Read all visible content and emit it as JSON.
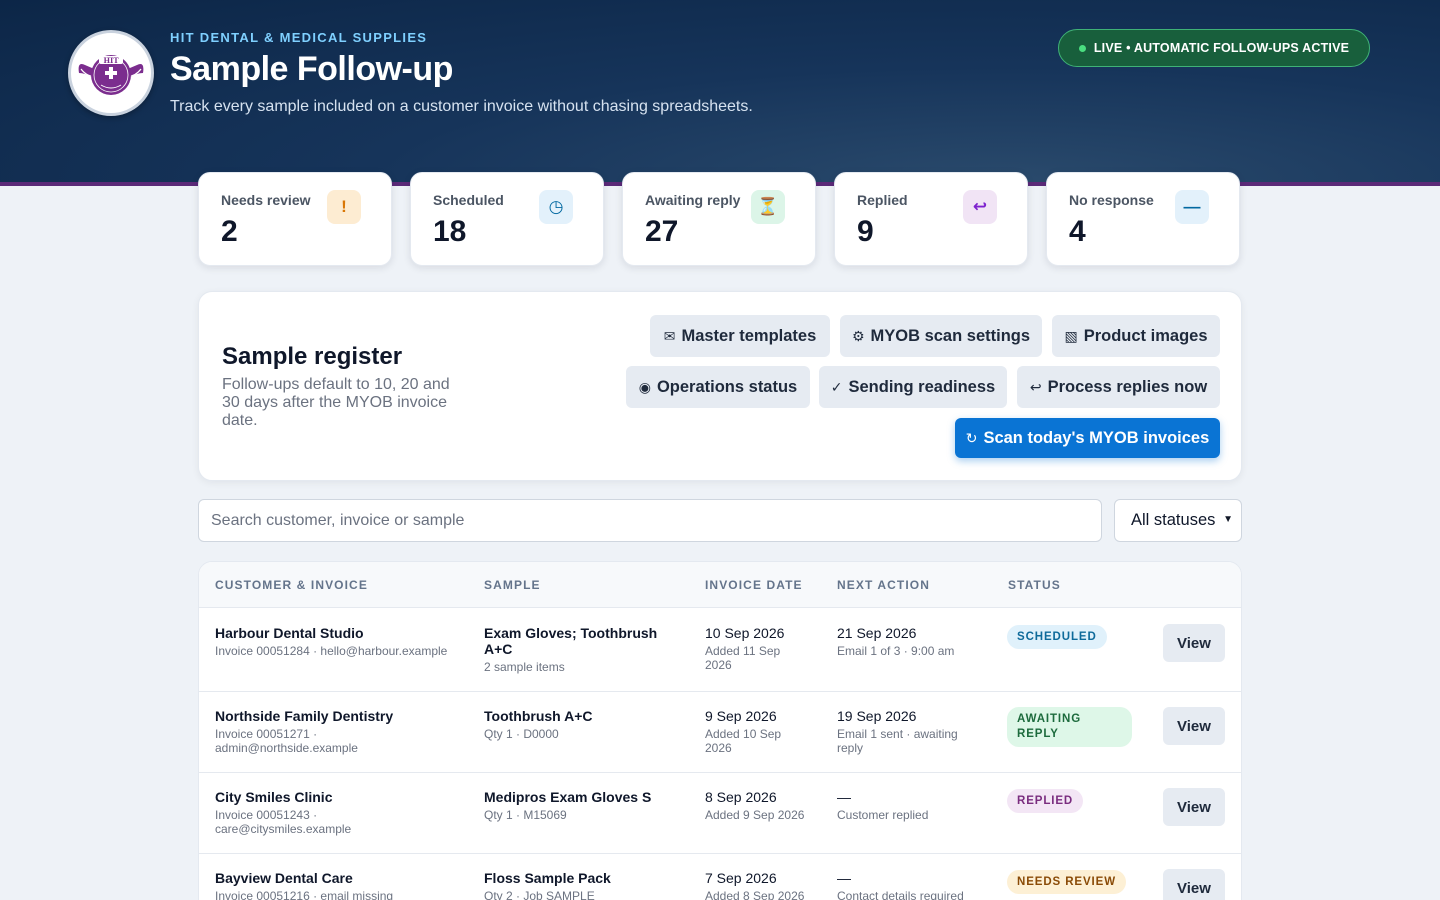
{
  "header": {
    "brand": "HIT DENTAL & MEDICAL SUPPLIES",
    "title": "Sample Follow-up",
    "subtitle": "Track every sample included on a customer invoice without chasing spreadsheets.",
    "live_badge": "LIVE • AUTOMATIC FOLLOW-UPS ACTIVE",
    "logo_text": "HIT"
  },
  "stats": [
    {
      "label": "Needs review",
      "value": "2",
      "icon": "!",
      "icon_name": "exclamation-icon",
      "color": "#d97706",
      "bg": "#fdecd2"
    },
    {
      "label": "Scheduled",
      "value": "18",
      "icon": "◷",
      "icon_name": "clock-icon",
      "color": "#0369a1",
      "bg": "#e3f1fb"
    },
    {
      "label": "Awaiting reply",
      "value": "27",
      "icon": "⏳",
      "icon_name": "hourglass-icon",
      "color": "#a16207",
      "bg": "#dcf5e8"
    },
    {
      "label": "Replied",
      "value": "9",
      "icon": "↩",
      "icon_name": "reply-icon",
      "color": "#7e22ce",
      "bg": "#f1e4f5"
    },
    {
      "label": "No response",
      "value": "4",
      "icon": "—",
      "icon_name": "dash-icon",
      "color": "#0369a1",
      "bg": "#e3f1fb"
    }
  ],
  "register": {
    "title": "Sample register",
    "description": "Follow-ups default to 10, 20 and 30 days after the MYOB invoice date.",
    "buttons": {
      "master_templates": {
        "icon": "✉",
        "label": "Master templates"
      },
      "myob_scan_settings": {
        "icon": "⚙",
        "label": "MYOB scan settings"
      },
      "product_images": {
        "icon": "▧",
        "label": "Product images"
      },
      "operations_status": {
        "icon": "◉",
        "label": "Operations status"
      },
      "sending_readiness": {
        "icon": "✓",
        "label": "Sending readiness"
      },
      "process_replies": {
        "icon": "↩",
        "label": "Process replies now"
      },
      "scan_invoices": {
        "icon": "↻",
        "label": "Scan today's MYOB invoices"
      }
    }
  },
  "filters": {
    "search_placeholder": "Search customer, invoice or sample",
    "status_selected": "All statuses"
  },
  "table": {
    "columns": [
      "CUSTOMER & INVOICE",
      "SAMPLE",
      "INVOICE DATE",
      "NEXT ACTION",
      "STATUS"
    ],
    "view_label": "View",
    "rows": [
      {
        "customer": "Harbour Dental Studio",
        "invoice": "Invoice 00051284 · hello@harbour.example",
        "sample": "Exam Gloves; Toothbrush A+C",
        "sample_detail": "2 sample items",
        "invoice_date": "10 Sep 2026",
        "added": "Added 11 Sep 2026",
        "next_action": "21 Sep 2026",
        "next_detail": "Email 1 of 3 · 9:00 am",
        "status": "SCHEDULED"
      },
      {
        "customer": "Northside Family Dentistry",
        "invoice": "Invoice 00051271 · admin@northside.example",
        "sample": "Toothbrush A+C",
        "sample_detail": "Qty 1 · D0000",
        "invoice_date": "9 Sep 2026",
        "added": "Added 10 Sep 2026",
        "next_action": "19 Sep 2026",
        "next_detail": "Email 1 sent · awaiting reply",
        "status": "AWAITING REPLY"
      },
      {
        "customer": "City Smiles Clinic",
        "invoice": "Invoice 00051243 · care@citysmiles.example",
        "sample": "Medipros Exam Gloves S",
        "sample_detail": "Qty 1 · M15069",
        "invoice_date": "8 Sep 2026",
        "added": "Added 9 Sep 2026",
        "next_action": "—",
        "next_detail": "Customer replied",
        "status": "REPLIED"
      },
      {
        "customer": "Bayview Dental Care",
        "invoice": "Invoice 00051216 · email missing",
        "sample": "Floss Sample Pack",
        "sample_detail": "Qty 2 · Job SAMPLE",
        "invoice_date": "7 Sep 2026",
        "added": "Added 8 Sep 2026",
        "next_action": "—",
        "next_detail": "Contact details required",
        "status": "NEEDS REVIEW"
      }
    ]
  }
}
